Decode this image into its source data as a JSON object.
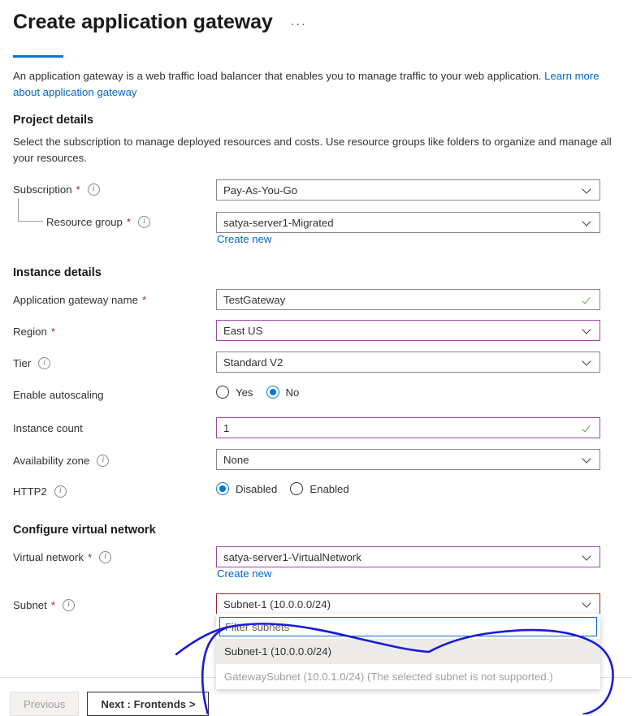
{
  "header": {
    "title": "Create application gateway",
    "more_menu": "···",
    "intro_text": "An application gateway is a web traffic load balancer that enables you to manage traffic to your web application. ",
    "intro_link": "Learn more about application gateway"
  },
  "project_details": {
    "heading": "Project details",
    "description": "Select the subscription to manage deployed resources and costs. Use resource groups like folders to organize and manage all your resources.",
    "subscription": {
      "label": "Subscription",
      "required": "*",
      "value": "Pay-As-You-Go"
    },
    "resource_group": {
      "label": "Resource group",
      "required": "*",
      "value": "satya-server1-Migrated",
      "create_new": "Create new"
    }
  },
  "instance_details": {
    "heading": "Instance details",
    "gateway_name": {
      "label": "Application gateway name",
      "required": "*",
      "value": "TestGateway"
    },
    "region": {
      "label": "Region",
      "required": "*",
      "value": "East US"
    },
    "tier": {
      "label": "Tier",
      "value": "Standard V2"
    },
    "autoscaling": {
      "label": "Enable autoscaling",
      "options": [
        "Yes",
        "No"
      ],
      "selected": "No"
    },
    "instance_count": {
      "label": "Instance count",
      "value": "1"
    },
    "availability_zone": {
      "label": "Availability zone",
      "value": "None"
    },
    "http2": {
      "label": "HTTP2",
      "options": [
        "Disabled",
        "Enabled"
      ],
      "selected": "Disabled"
    }
  },
  "virtual_network": {
    "heading": "Configure virtual network",
    "vnet": {
      "label": "Virtual network",
      "required": "*",
      "value": "satya-server1-VirtualNetwork",
      "create_new": "Create new"
    },
    "subnet": {
      "label": "Subnet",
      "required": "*",
      "value": "Subnet-1 (10.0.0.0/24)",
      "filter_placeholder": "Filter subnets",
      "filter_value": "",
      "options": [
        {
          "label": "Subnet-1 (10.0.0.0/24)",
          "state": "highlight"
        },
        {
          "label": "GatewaySubnet (10.0.1.0/24) (The selected subnet is not supported.)",
          "state": "disabled"
        }
      ]
    }
  },
  "footer": {
    "previous": "Previous",
    "next": "Next : Frontends >"
  },
  "colors": {
    "accent": "#0078d4",
    "link": "#0066cc",
    "required": "#a4262c",
    "valid_check": "#5aa53f",
    "field_border": "#8a8886",
    "field_border_visited": "#9a49a5",
    "field_border_error": "#8e2a2a",
    "filter_focus": "#0f6cbd",
    "option_highlight": "#edebe9",
    "annotation_ink": "#1a1ad6"
  },
  "icons": {
    "info": "ⓘ",
    "chevron_down": "chevron-down",
    "valid": "checkmark"
  }
}
